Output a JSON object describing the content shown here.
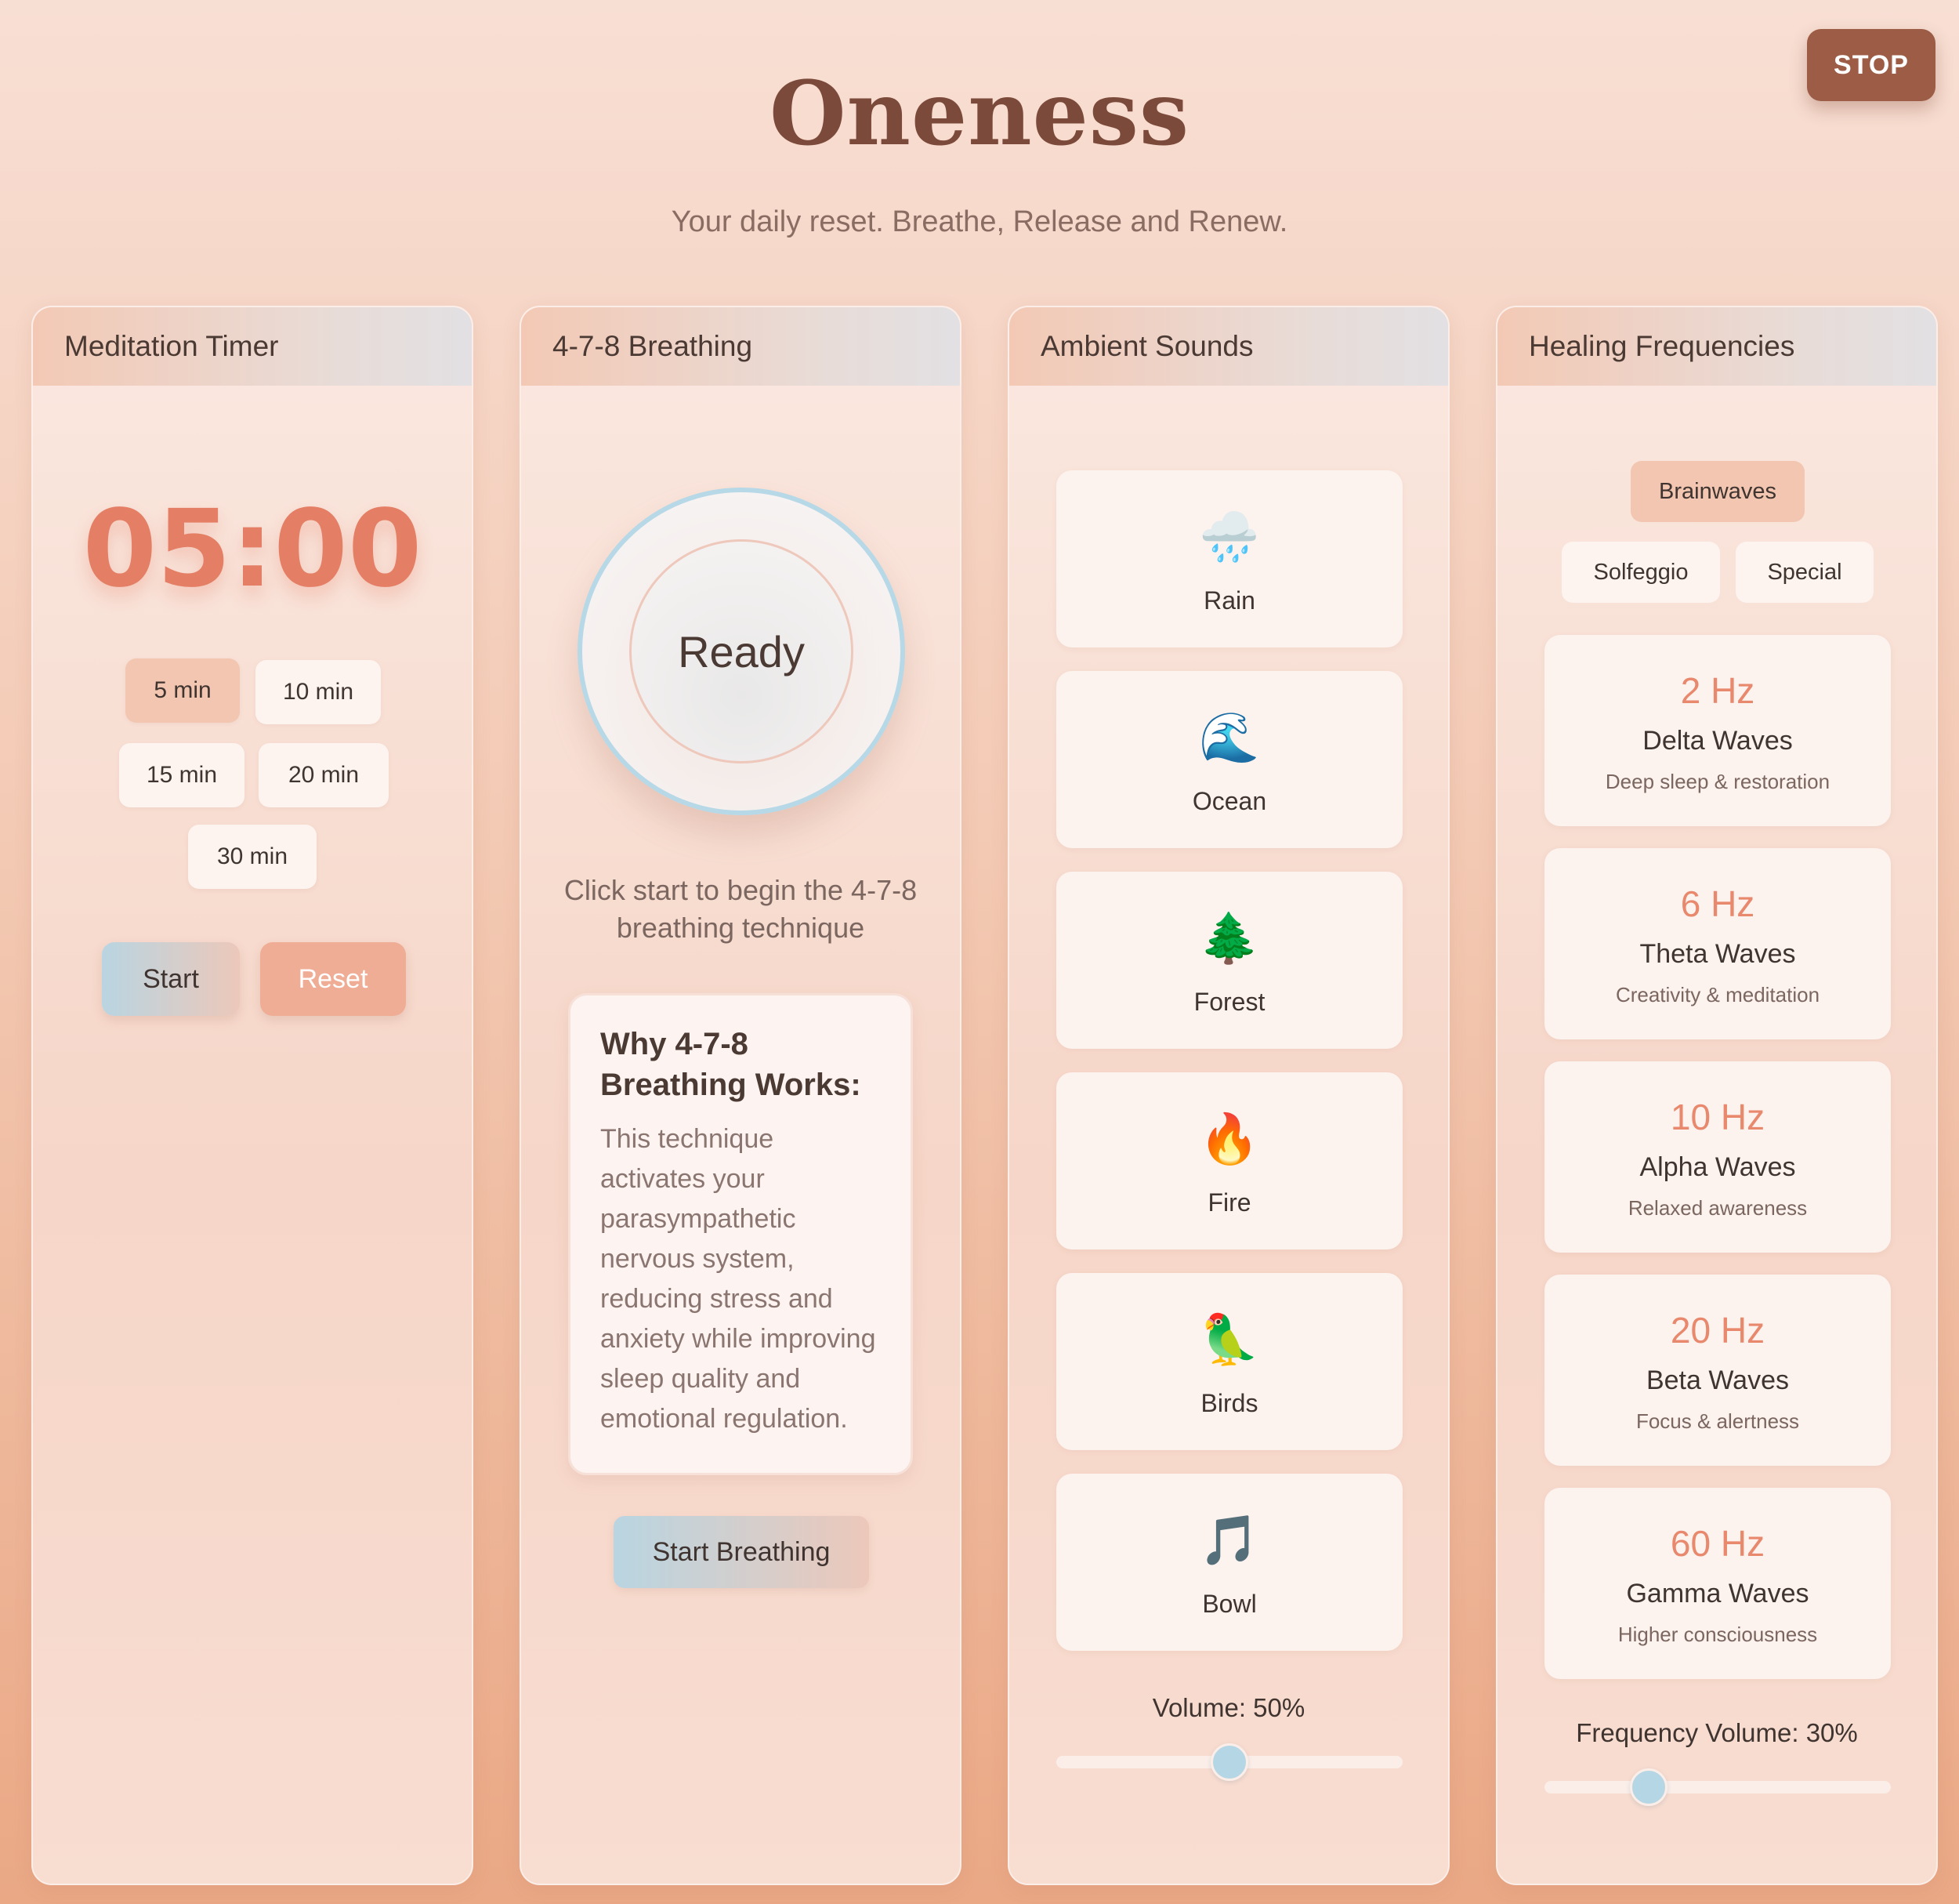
{
  "app": {
    "title": "Oneness",
    "subtitle": "Your daily reset. Breathe, Release and Renew.",
    "stop_label": "STOP"
  },
  "timer": {
    "header": "Meditation Timer",
    "display": "05:00",
    "durations": [
      "5 min",
      "10 min",
      "15 min",
      "20 min",
      "30 min"
    ],
    "selected_duration": "5 min",
    "start_label": "Start",
    "reset_label": "Reset"
  },
  "breathing": {
    "header": "4-7-8 Breathing",
    "state": "Ready",
    "instruction": "Click start to begin the 4-7-8 breathing technique",
    "info_title": "Why 4-7-8 Breathing Works:",
    "info_body": "This technique activates your parasympathetic nervous system, reducing stress and anxiety while improving sleep quality and emotional regulation.",
    "start_label": "Start Breathing"
  },
  "sounds": {
    "header": "Ambient Sounds",
    "items": [
      {
        "icon": "🌧️",
        "icon_name": "rain-cloud-icon",
        "label": "Rain"
      },
      {
        "icon": "🌊",
        "icon_name": "wave-icon",
        "label": "Ocean"
      },
      {
        "icon": "🌲",
        "icon_name": "tree-icon",
        "label": "Forest"
      },
      {
        "icon": "🔥",
        "icon_name": "fire-icon",
        "label": "Fire"
      },
      {
        "icon": "🦜",
        "icon_name": "parrot-icon",
        "label": "Birds"
      },
      {
        "icon": "🎵",
        "icon_name": "music-note-icon",
        "label": "Bowl"
      }
    ],
    "volume_label": "Volume: 50%",
    "volume": 0.5
  },
  "frequencies": {
    "header": "Healing Frequencies",
    "tabs": [
      "Brainwaves",
      "Solfeggio",
      "Special"
    ],
    "active_tab": "Brainwaves",
    "items": [
      {
        "hz": "2 Hz",
        "name": "Delta Waves",
        "desc": "Deep sleep & restoration"
      },
      {
        "hz": "6 Hz",
        "name": "Theta Waves",
        "desc": "Creativity & meditation"
      },
      {
        "hz": "10 Hz",
        "name": "Alpha Waves",
        "desc": "Relaxed awareness"
      },
      {
        "hz": "20 Hz",
        "name": "Beta Waves",
        "desc": "Focus & alertness"
      },
      {
        "hz": "60 Hz",
        "name": "Gamma Waves",
        "desc": "Higher consciousness"
      }
    ],
    "volume_label": "Frequency Volume: 30%",
    "volume": 0.3
  },
  "colors": {
    "accent": "#e47e65",
    "stop_button": "#9c5c46",
    "slider_thumb": "#b5d6e4",
    "active_chip": "#f2c6b0"
  }
}
